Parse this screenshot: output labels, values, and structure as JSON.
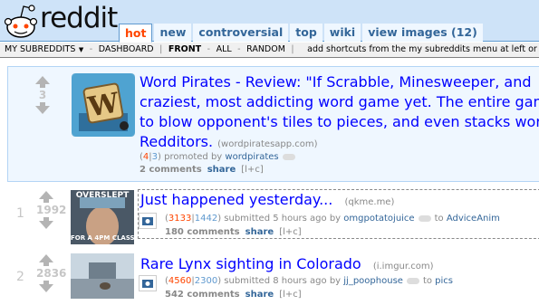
{
  "header": {
    "site": "reddit",
    "tabs": [
      "hot",
      "new",
      "controversial",
      "top",
      "wiki",
      "view images (12)"
    ],
    "active_tab": "hot"
  },
  "srbar": {
    "items": [
      "MY SUBREDDITS",
      "DASHBOARD",
      "FRONT",
      "ALL",
      "RANDOM"
    ],
    "hint": "add shortcuts from the my subreddits menu at left or"
  },
  "promoted": {
    "score": "3",
    "title_lines": [
      "Word Pirates - Review: \"If Scrabble, Minesweeper, and",
      "craziest, most addicting word game yet. The entire gam",
      "to blow opponent's tiles to pieces, and even stacks wor",
      "Redditors."
    ],
    "domain": "(wordpiratesapp.com)",
    "ups": "4",
    "downs": "3",
    "promoted_by": "promoted by",
    "author": "wordpirates",
    "comments": "2 comments",
    "share": "share",
    "lc": "[l+c]"
  },
  "posts": [
    {
      "rank": "1",
      "score": "1992",
      "title": "Just happened yesterday...",
      "domain": "(qkme.me)",
      "ups": "3133",
      "downs": "1442",
      "submitted": "submitted 5 hours ago by",
      "author": "omgpotatojuice",
      "to": "to",
      "subreddit": "AdviceAnim",
      "comments": "180 comments",
      "share": "share",
      "lc": "[l+c]",
      "meme_top": "OVERSLEPT",
      "meme_bottom": "FOR A 4PM CLASS"
    },
    {
      "rank": "2",
      "score": "2836",
      "title": "Rare Lynx sighting in Colorado",
      "domain": "(i.imgur.com)",
      "ups": "4560",
      "downs": "2300",
      "submitted": "submitted 8 hours ago by",
      "author": "jj_poophouse",
      "to": "to",
      "subreddit": "pics",
      "comments": "542 comments",
      "share": "share",
      "lc": "[l+c]"
    }
  ],
  "colors": {
    "header_bg": "#cee3f8",
    "link": "#0000ff",
    "upvote": "#ff4500",
    "downvote": "#5f99cf"
  }
}
